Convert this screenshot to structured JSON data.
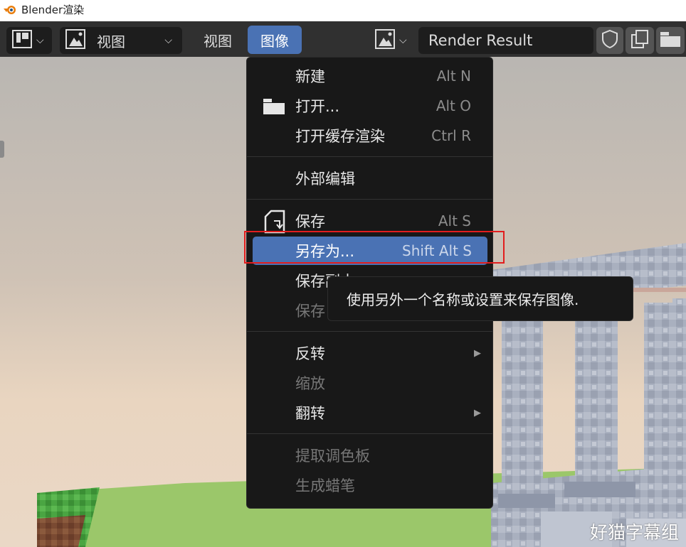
{
  "window": {
    "title": "Blender渲染"
  },
  "header": {
    "editor_dropdown_label": "视图",
    "menus": [
      "视图",
      "图像"
    ],
    "image_name": "Render Result"
  },
  "menu": {
    "items": [
      {
        "label": "新建",
        "shortcut": "Alt N"
      },
      {
        "label": "打开...",
        "shortcut": "Alt O"
      },
      {
        "label": "打开缓存渲染",
        "shortcut": "Ctrl R"
      },
      {
        "label": "外部编辑",
        "shortcut": ""
      },
      {
        "label": "保存",
        "shortcut": "Alt S"
      },
      {
        "label": "另存为...",
        "shortcut": "Shift Alt S"
      },
      {
        "label": "保存副本",
        "shortcut": ""
      },
      {
        "label": "保存",
        "shortcut": ""
      },
      {
        "label": "反转",
        "shortcut": ""
      },
      {
        "label": "缩放",
        "shortcut": ""
      },
      {
        "label": "翻转",
        "shortcut": ""
      },
      {
        "label": "提取调色板",
        "shortcut": ""
      },
      {
        "label": "生成蜡笔",
        "shortcut": ""
      }
    ]
  },
  "tooltip": {
    "text": "使用另外一个名称或设置来保存图像."
  },
  "watermark": "好猫字幕组",
  "colors": {
    "accent": "#4a72b4",
    "highlight_box": "#e21e1e",
    "menu_bg": "#181818",
    "header_bg": "#303030"
  }
}
